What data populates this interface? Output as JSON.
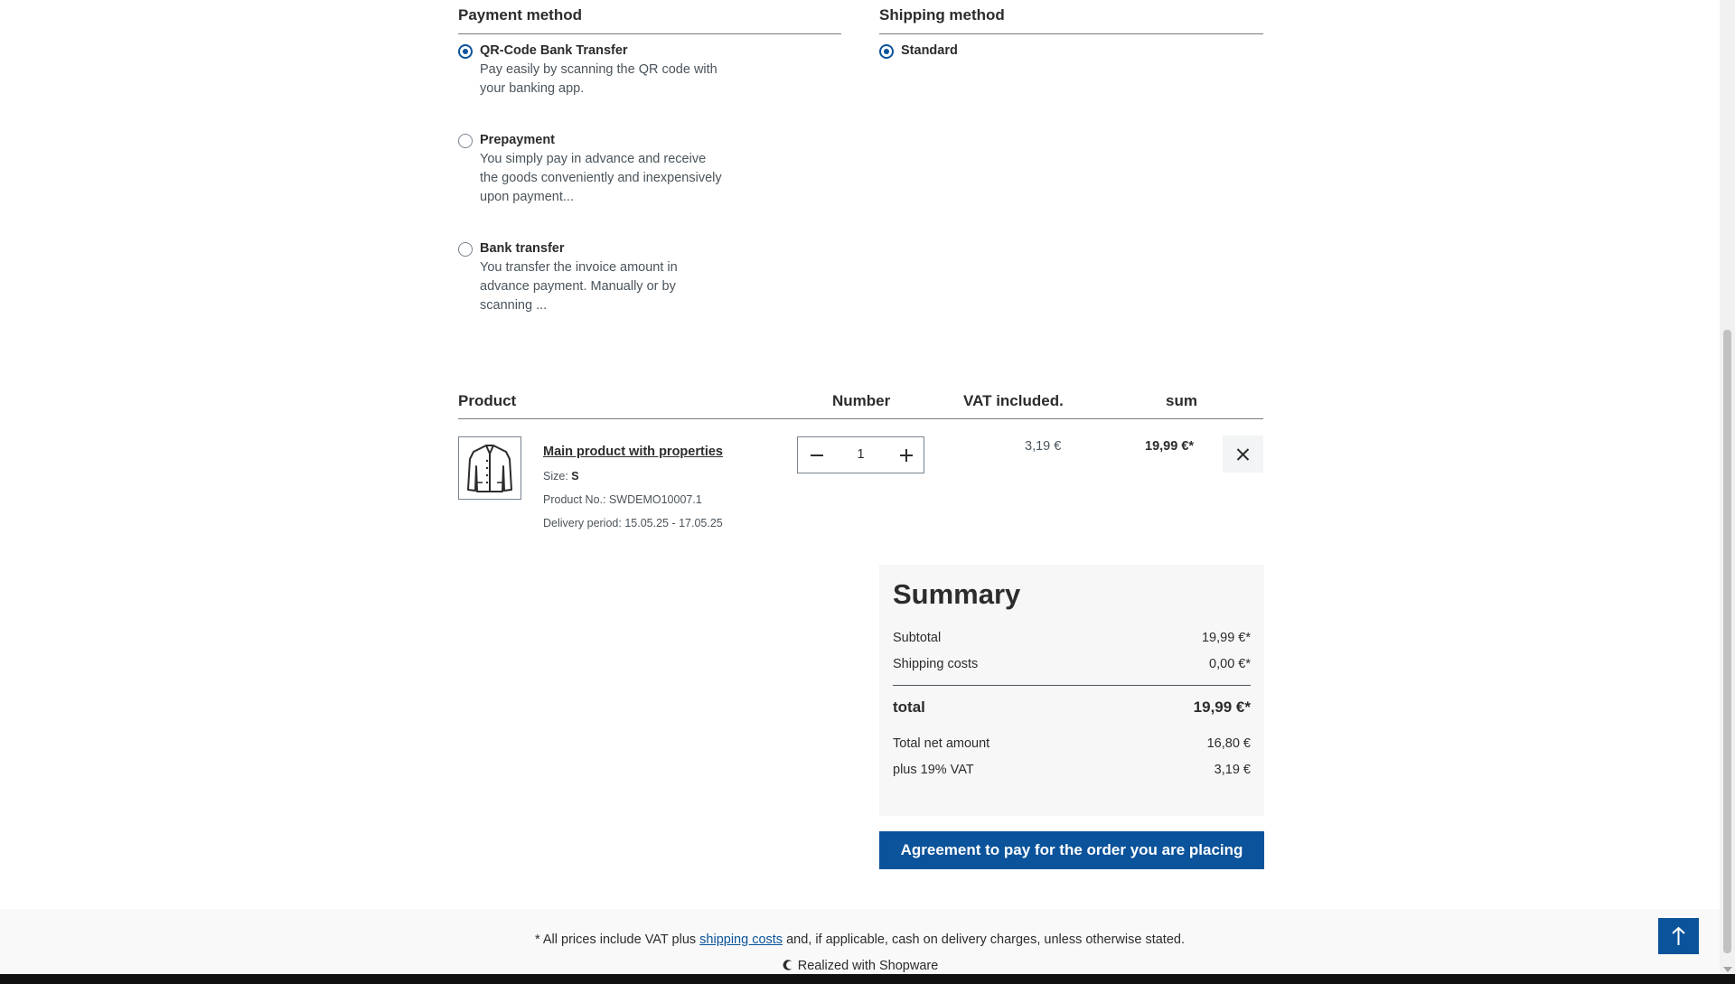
{
  "payment": {
    "title": "Payment method",
    "options": [
      {
        "label": "QR-Code Bank Transfer",
        "desc": "Pay easily by scanning the QR code with your banking app.",
        "selected": true
      },
      {
        "label": "Prepayment",
        "desc": "You simply pay in advance and receive the goods conveniently and inexpensively upon payment...",
        "selected": false
      },
      {
        "label": "Bank transfer",
        "desc": "You transfer the invoice amount in advance payment. Manually or by scanning ...",
        "selected": false
      }
    ]
  },
  "shipping": {
    "title": "Shipping method",
    "options": [
      {
        "label": "Standard",
        "selected": true
      }
    ]
  },
  "cart": {
    "headers": {
      "product": "Product",
      "number": "Number",
      "vat": "VAT included.",
      "sum": "sum"
    },
    "item": {
      "name": "Main product with properties",
      "size_label": "Size:",
      "size_value": "S",
      "product_no": "Product No.: SWDEMO10007.1",
      "delivery": "Delivery period: 15.05.25 - 17.05.25",
      "quantity": "1",
      "vat": "3,19 €",
      "sum": "19,99 €*",
      "image_icon": "jacket-icon"
    }
  },
  "summary": {
    "title": "Summary",
    "subtotal_label": "Subtotal",
    "subtotal": "19,99 €*",
    "shipping_label": "Shipping costs",
    "shipping": "0,00 €*",
    "total_label": "total",
    "total": "19,99 €*",
    "net_label": "Total net amount",
    "net": "16,80 €",
    "vat_label": "plus 19% VAT",
    "vat": "3,19 €"
  },
  "cta_label": "Agreement to pay for the order you are placing",
  "footer": {
    "note_prefix": "* All prices include VAT plus ",
    "note_link": "shipping costs",
    "note_suffix": " and, if applicable, cash on delivery charges, unless otherwise stated.",
    "realized": "Realized with Shopware"
  },
  "colors": {
    "primary": "#0b539b",
    "text": "#2c2c2c",
    "muted": "#4a545b",
    "summary_bg": "#f7f7f7"
  }
}
